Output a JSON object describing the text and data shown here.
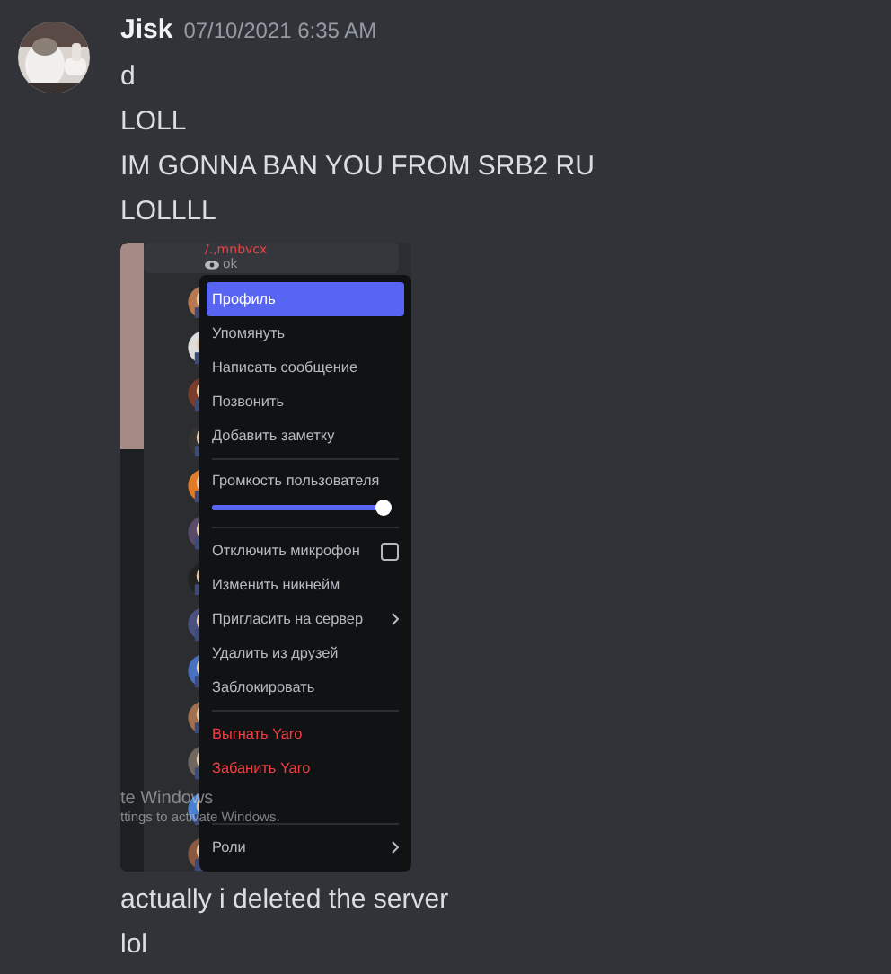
{
  "message": {
    "author": "Jisk",
    "timestamp": "07/10/2021 6:35 AM",
    "lines_before": [
      "d",
      "LOLL",
      "IM GONNA BAN YOU FROM SRB2 RU",
      "LOLLLL"
    ],
    "attachment": {
      "member": {
        "name": "/.,mnbvcx",
        "status": "ok"
      },
      "menu": [
        {
          "kind": "item",
          "label": "Профиль",
          "selected": true
        },
        {
          "kind": "item",
          "label": "Упомянуть",
          "selected": false
        },
        {
          "kind": "item",
          "label": "Написать сообщение",
          "selected": false
        },
        {
          "kind": "item",
          "label": "Позвонить",
          "selected": false
        },
        {
          "kind": "item",
          "label": "Добавить заметку",
          "selected": false
        },
        {
          "kind": "separator"
        },
        {
          "kind": "slider",
          "label": "Громкость пользователя",
          "level": 1.0
        },
        {
          "kind": "separator"
        },
        {
          "kind": "checkbox",
          "label": "Отключить микрофон",
          "checked": false
        },
        {
          "kind": "item",
          "label": "Изменить никнейм",
          "selected": false
        },
        {
          "kind": "submenu",
          "label": "Пригласить на сервер",
          "selected": false
        },
        {
          "kind": "item",
          "label": "Удалить из друзей",
          "selected": false
        },
        {
          "kind": "item",
          "label": "Заблокировать",
          "selected": false
        },
        {
          "kind": "separator"
        },
        {
          "kind": "danger",
          "label": "Выгнать Yaro",
          "selected": false
        },
        {
          "kind": "danger",
          "label": "Забанить Yaro",
          "selected": false
        },
        {
          "kind": "separator"
        },
        {
          "kind": "submenu",
          "label": "Роли",
          "selected": false
        }
      ],
      "activation_notice": [
        "te Windows",
        "ttings to activate Windows."
      ]
    },
    "lines_after": [
      "actually i deleted the server",
      "lol"
    ]
  }
}
